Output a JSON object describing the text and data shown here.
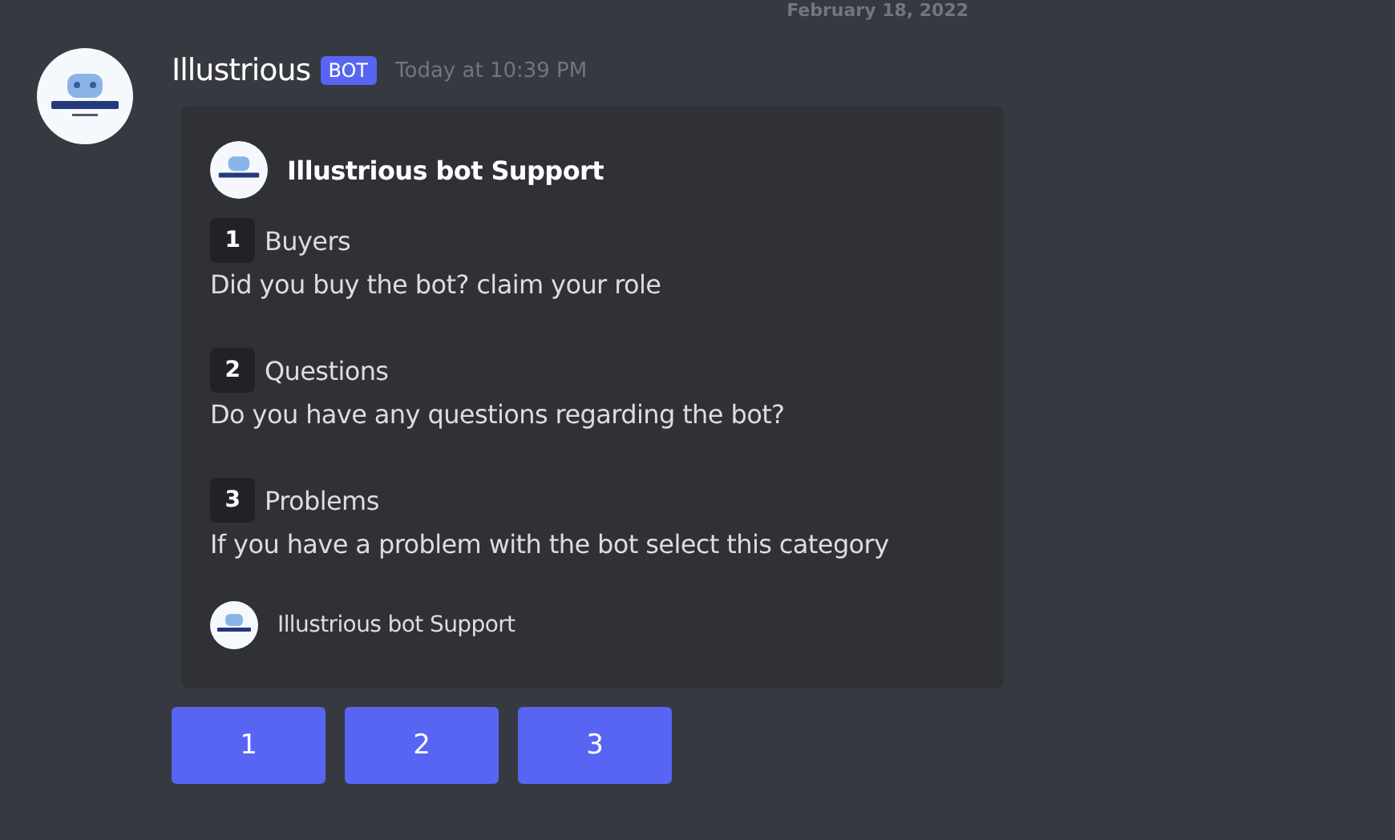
{
  "date_divider": "February 18, 2022",
  "message": {
    "author": "Illustrious",
    "tag": "BOT",
    "timestamp": "Today at 10:39 PM",
    "embed": {
      "author": "Illustrious bot Support",
      "fields": [
        {
          "key": "1",
          "title": "Buyers",
          "text": "Did you buy the bot? claim your role"
        },
        {
          "key": "2",
          "title": "Questions",
          "text": "Do you have any questions regarding the bot?"
        },
        {
          "key": "3",
          "title": "Problems",
          "text": "If you have a problem with the bot select this category"
        }
      ],
      "footer": "Illustrious bot Support"
    },
    "buttons": [
      "1",
      "2",
      "3"
    ]
  }
}
